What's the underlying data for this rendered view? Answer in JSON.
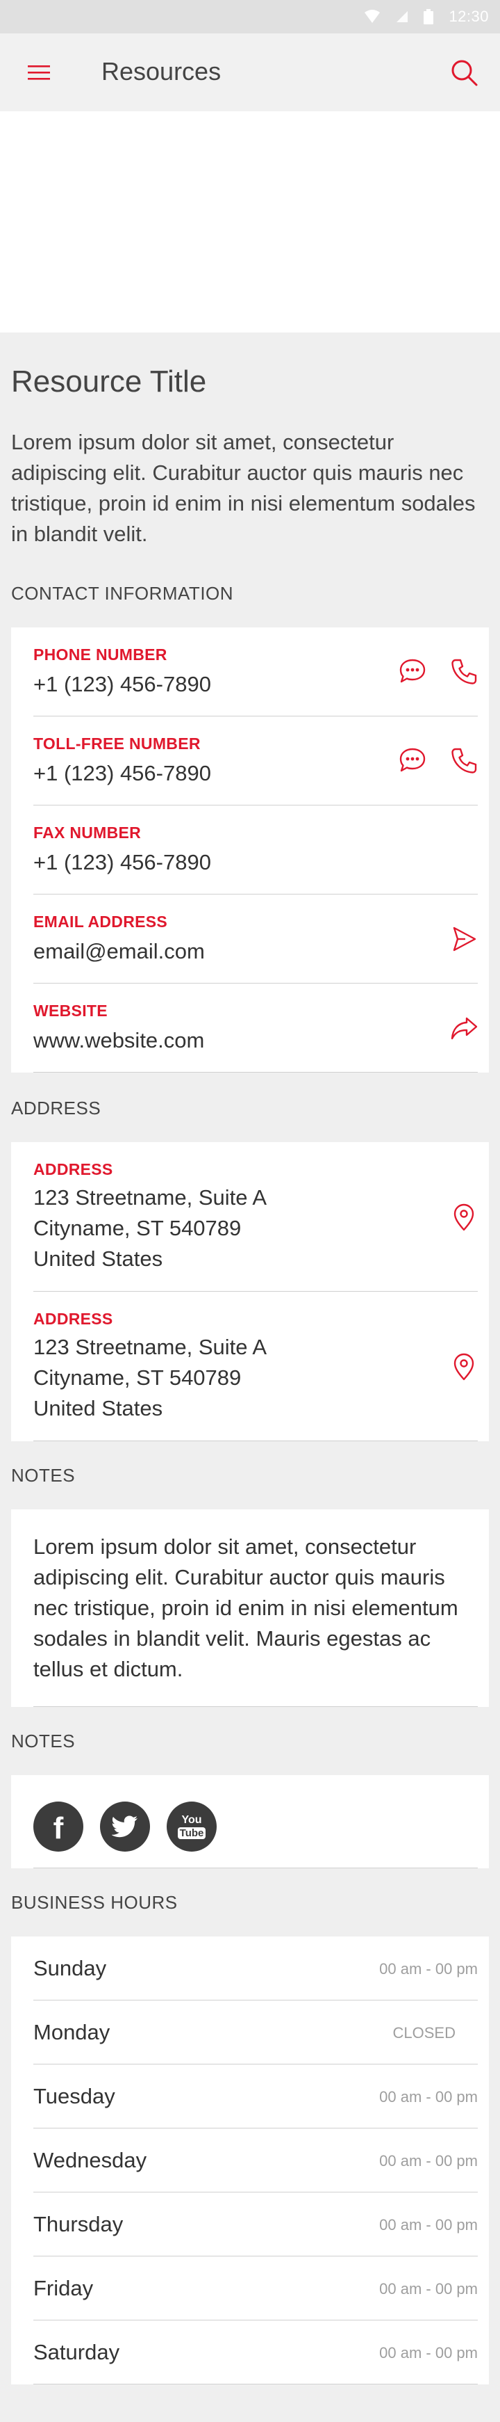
{
  "status_bar": {
    "time": "12:30"
  },
  "app_bar": {
    "title": "Resources"
  },
  "resource": {
    "title": "Resource Title",
    "description": "Lorem ipsum dolor sit amet, consectetur adipiscing elit. Curabitur auctor quis mauris nec tristique, proin id enim in nisi elementum sodales in blandit velit."
  },
  "contact": {
    "heading": "CONTACT INFORMATION",
    "phone": {
      "label": "PHONE NUMBER",
      "value": "+1 (123) 456-7890"
    },
    "tollfree": {
      "label": "TOLL-FREE NUMBER",
      "value": "+1 (123) 456-7890"
    },
    "fax": {
      "label": "FAX NUMBER",
      "value": "+1 (123) 456-7890"
    },
    "email": {
      "label": "EMAIL ADDRESS",
      "value": "email@email.com"
    },
    "website": {
      "label": "WEBSITE",
      "value": "www.website.com"
    }
  },
  "address": {
    "heading": "ADDRESS",
    "items": [
      {
        "label": "ADDRESS",
        "line1": "123 Streetname, Suite A",
        "line2": "Cityname, ST 540789",
        "line3": "United States"
      },
      {
        "label": "ADDRESS",
        "line1": "123 Streetname, Suite A",
        "line2": "Cityname, ST 540789",
        "line3": "United States"
      }
    ]
  },
  "notes": {
    "heading": "NOTES",
    "text": "Lorem ipsum dolor sit amet, consectetur adipiscing elit. Curabitur auctor quis mauris nec tristique, proin id enim in nisi elementum sodales in blandit velit. Mauris egestas ac tellus et dictum."
  },
  "social": {
    "heading": "NOTES",
    "items": [
      {
        "icon": "facebook-icon",
        "label": "f"
      },
      {
        "icon": "twitter-icon",
        "label": ""
      },
      {
        "icon": "youtube-icon",
        "label_top": "You",
        "label_bottom": "Tube"
      }
    ]
  },
  "hours": {
    "heading": "BUSINESS HOURS",
    "days": [
      {
        "day": "Sunday",
        "time": "00 am - 00 pm"
      },
      {
        "day": "Monday",
        "time": "CLOSED"
      },
      {
        "day": "Tuesday",
        "time": "00 am - 00 pm"
      },
      {
        "day": "Wednesday",
        "time": "00 am - 00 pm"
      },
      {
        "day": "Thursday",
        "time": "00 am - 00 pm"
      },
      {
        "day": "Friday",
        "time": "00 am - 00 pm"
      },
      {
        "day": "Saturday",
        "time": "00 am - 00 pm"
      }
    ]
  },
  "colors": {
    "accent": "#e0182d",
    "background": "#efefef",
    "card": "#ffffff",
    "divider": "#d0d0d0",
    "social": "#3c3c3c"
  }
}
